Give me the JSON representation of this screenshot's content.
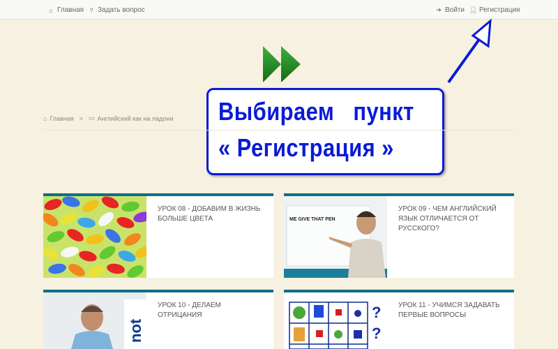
{
  "topnav": {
    "home_label": "Главная",
    "ask_label": "Задать вопрос",
    "login_label": "Войти",
    "register_label": "Регистрация"
  },
  "hint": {
    "line1": "Выбираем   пункт",
    "line2": "« Регистрация »"
  },
  "breadcrumb": {
    "home": "Главная",
    "separator": ">",
    "current": "Английский как на ладони"
  },
  "lessons": [
    {
      "title": "УРОК 08 - ДОБАВИМ В ЖИЗНЬ БОЛЬШЕ ЦВЕТА",
      "thumb": "candy-image"
    },
    {
      "title": "УРОК 09 - ЧЕМ АНГЛИЙСКИЙ ЯЗЫК ОТЛИЧАЕТСЯ ОТ РУССКОГО?",
      "thumb": "teacher-whiteboard-image",
      "board_text": "ME GIVE THAT PEN"
    },
    {
      "title": "УРОК 10 - ДЕЛАЕМ ОТРИЦАНИЯ",
      "thumb": "teacher-not-image",
      "overlay_word": "not"
    },
    {
      "title": "УРОК 11 - УЧИМСЯ ЗАДАВАТЬ ПЕРВЫЕ ВОПРОСЫ",
      "thumb": "question-grid-image"
    }
  ],
  "colors": {
    "background": "#f7f1e1",
    "accent_blue": "#0a1bd6",
    "card_top": "#0d6f86",
    "play_green": "#1f8a1f"
  }
}
